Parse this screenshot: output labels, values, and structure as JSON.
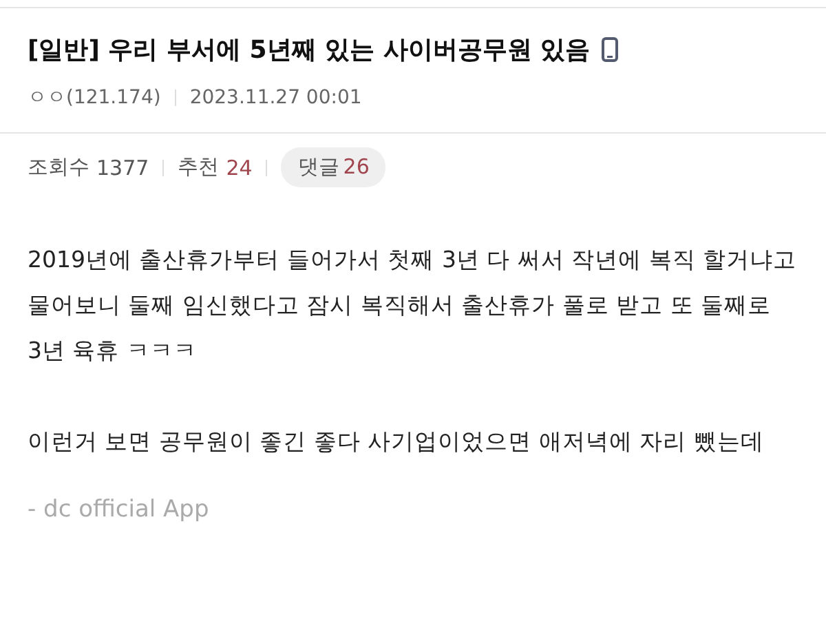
{
  "post": {
    "title": "[일반] 우리 부서에 5년째 있는 사이버공무원 있음",
    "author": "ㅇㅇ(121.174)",
    "date": "2023.11.27 00:01"
  },
  "stats": {
    "views_label": "조회수",
    "views": "1377",
    "recommend_label": "추천",
    "recommend": "24",
    "comments_label": "댓글",
    "comments": "26"
  },
  "body": [
    "2019년에 출산휴가부터 들어가서 첫째 3년 다 써서 작년에 복직 할거냐고 물어보니 둘째 임신했다고 잠시 복직해서 출산휴가 풀로 받고 또 둘째로 3년 육휴 ㅋㅋㅋ",
    "이런거 보면 공무원이 좋긴 좋다 사기업이었으면 애저녁에 자리 뺐는데"
  ],
  "footer": "- dc official App"
}
